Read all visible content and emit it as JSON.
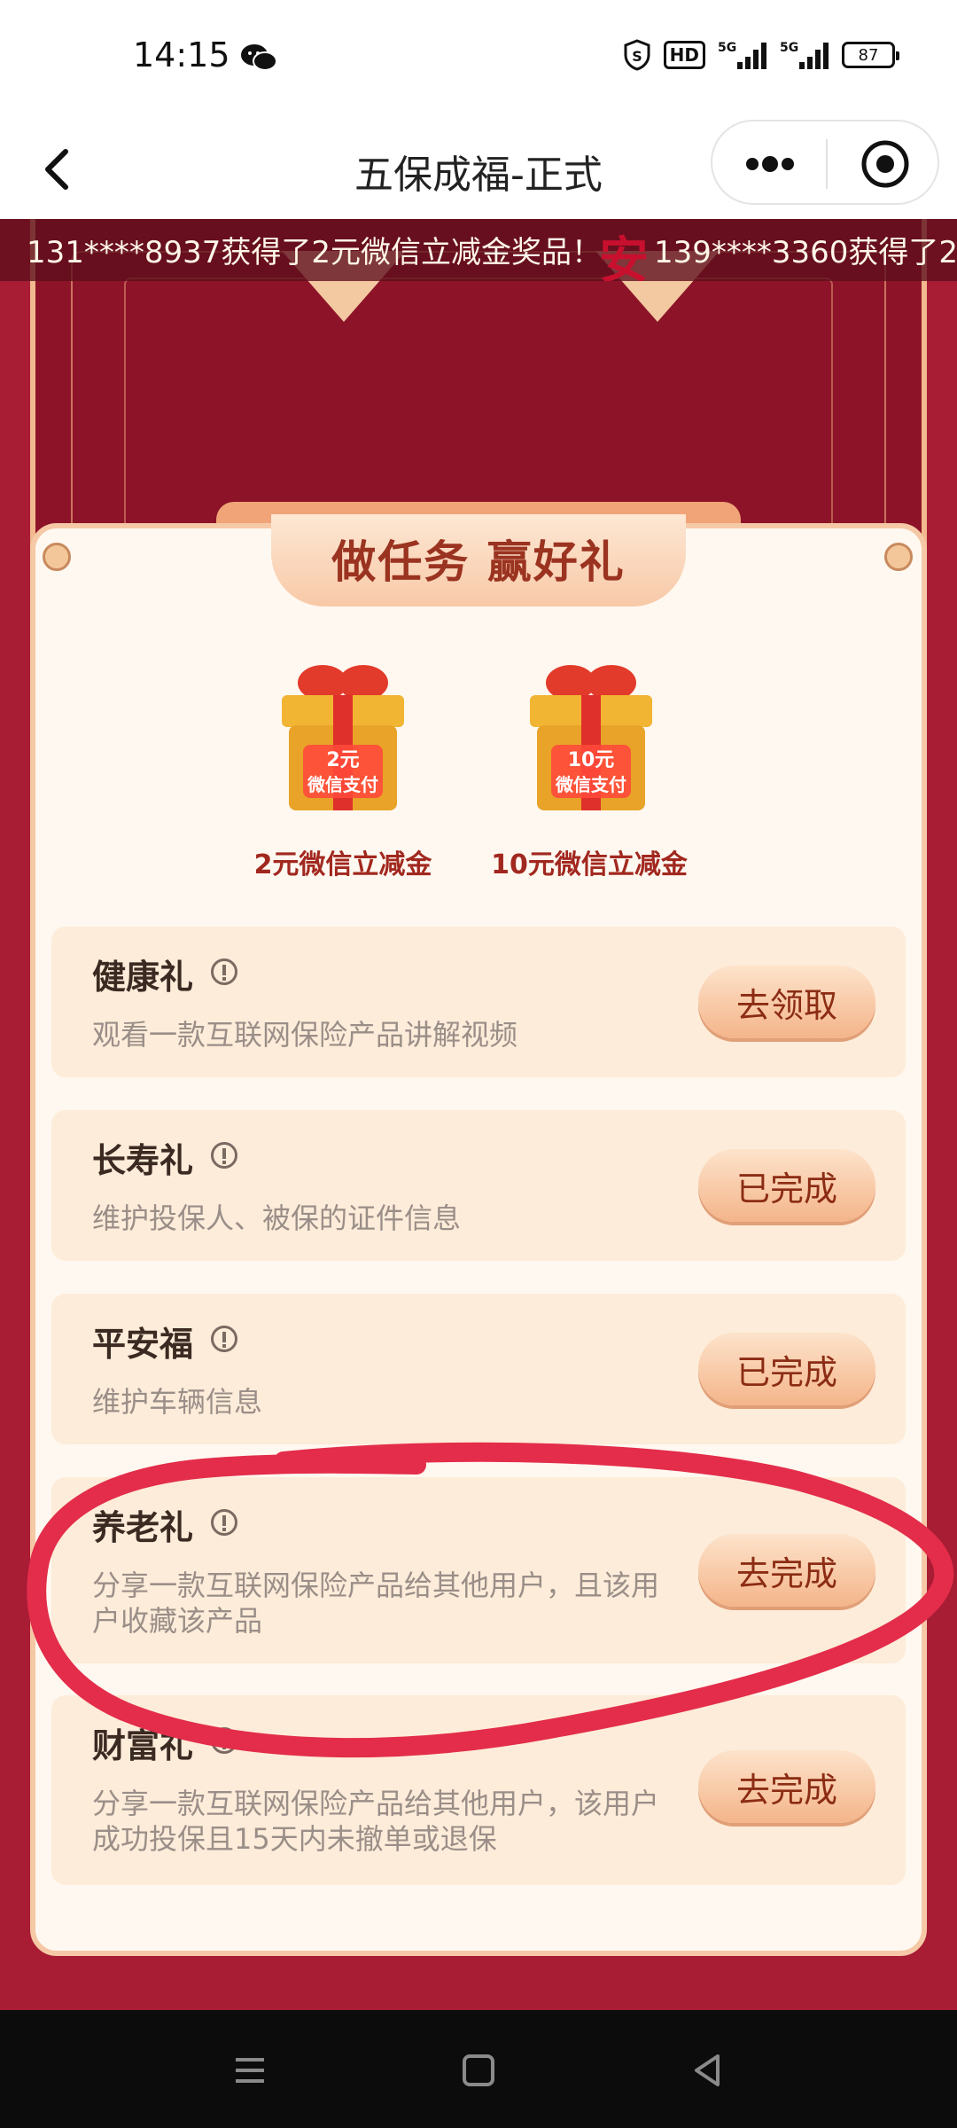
{
  "status_bar": {
    "time": "14:15",
    "battery": "87",
    "hd_label": "HD",
    "net1": "5G",
    "net2": "5G",
    "icons": [
      "wechat-icon",
      "shield-icon",
      "hd-icon",
      "signal-icon",
      "signal-icon",
      "battery-icon"
    ]
  },
  "nav": {
    "title": "五保成福-正式",
    "back_icon": "chevron-left-icon",
    "more_icon": "more-icon",
    "close_icon": "target-icon"
  },
  "ticker": {
    "text": "131****8937获得了2元微信立减金奖品！",
    "text2": "139****3360获得了2",
    "decor": "安"
  },
  "card": {
    "heading": "做任务 赢好礼",
    "gifts": [
      {
        "badge_top": "2元",
        "badge_bottom": "微信支付",
        "label": "2元微信立减金"
      },
      {
        "badge_top": "10元",
        "badge_bottom": "微信支付",
        "label": "10元微信立减金"
      }
    ],
    "tasks": [
      {
        "title": "健康礼",
        "desc": "观看一款互联网保险产品讲解视频",
        "button": "去领取"
      },
      {
        "title": "长寿礼",
        "desc": "维护投保人、被保的证件信息",
        "button": "已完成"
      },
      {
        "title": "平安福",
        "desc": "维护车辆信息",
        "button": "已完成"
      },
      {
        "title": "养老礼",
        "desc": "分享一款互联网保险产品给其他用户，且该用户收藏该产品",
        "button": "去完成"
      },
      {
        "title": "财富礼",
        "desc": "分享一款互联网保险产品给其他用户，该用户成功投保且15天内未撤单或退保",
        "button": "去完成"
      }
    ]
  },
  "colors": {
    "background_red": "#a81c34",
    "card_bg": "#fff8f0",
    "button_text": "#8c2c14",
    "annotation": "#e32d4a"
  },
  "system_nav": {
    "icons": [
      "menu-icon",
      "home-icon",
      "back-icon"
    ]
  }
}
